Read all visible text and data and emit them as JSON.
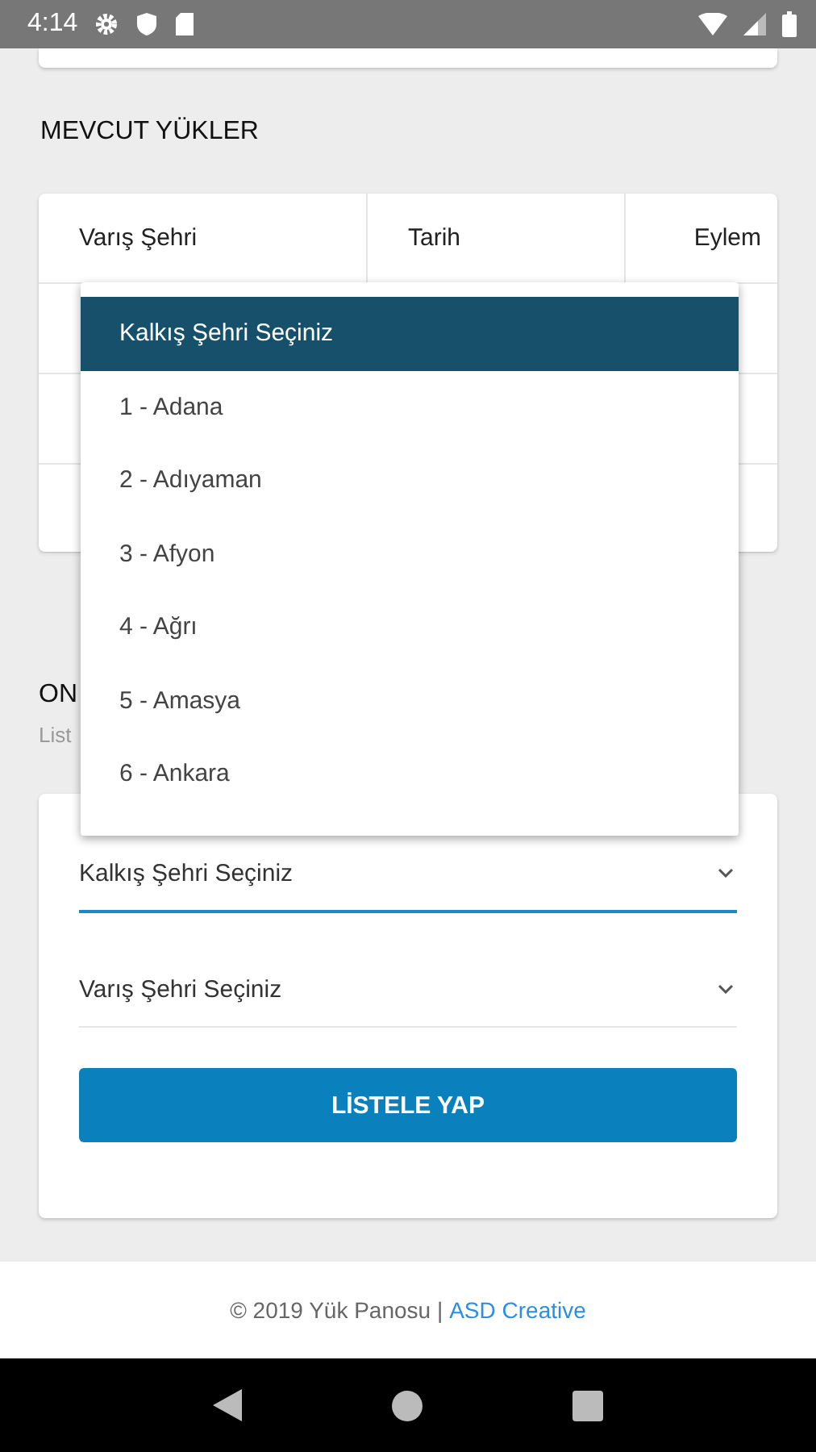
{
  "status_bar": {
    "time": "4:14"
  },
  "loads_section": {
    "title": "MEVCUT YÜKLER",
    "table": {
      "columns": [
        "Varış Şehri",
        "Tarih",
        "Eylem"
      ]
    }
  },
  "dropdown": {
    "options": [
      {
        "label": "Kalkış Şehri Seçiniz",
        "selected": true
      },
      {
        "label": "1 - Adana",
        "selected": false
      },
      {
        "label": "2 - Adıyaman",
        "selected": false
      },
      {
        "label": "3 - Afyon",
        "selected": false
      },
      {
        "label": "4 - Ağrı",
        "selected": false
      },
      {
        "label": "5 - Amasya",
        "selected": false
      },
      {
        "label": "6 - Ankara",
        "selected": false
      }
    ]
  },
  "search_section": {
    "title": "ON",
    "subtitle": "List"
  },
  "form": {
    "selects": [
      {
        "value": "Kalkış Şehri Seçiniz",
        "focused": true
      },
      {
        "value": "Varış Şehri Seçiniz",
        "focused": false
      }
    ],
    "button": "LİSTELE YAP"
  },
  "footer": {
    "text": "© 2019 Yük Panosu |",
    "link": "ASD Creative"
  }
}
